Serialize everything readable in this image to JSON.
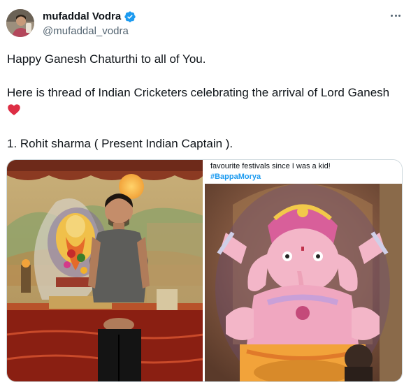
{
  "author": {
    "display_name": "mufaddal Vodra",
    "handle": "@mufaddal_vodra",
    "verified": true,
    "verified_icon": "verified-badge-icon",
    "accent_color": "#1d9bf0"
  },
  "tweet": {
    "line1": "Happy Ganesh Chaturthi to all of You.",
    "line2": "Here is thread of Indian Cricketers celebrating the arrival of Lord Ganesh",
    "heart_icon": "red-heart-icon",
    "line3": "1. Rohit sharma ( Present Indian Captain  )."
  },
  "media": {
    "left_image": "photo-cricketer-with-ganesh-idol",
    "right_image": {
      "caption": "favourite festivals since I was a kid!",
      "hashtag": "#BappaMorya"
    }
  },
  "more_icon": "more-options-icon"
}
